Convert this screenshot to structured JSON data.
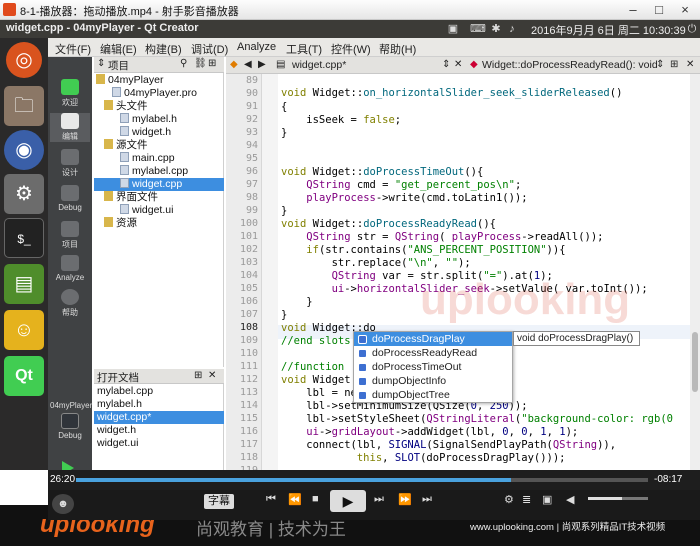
{
  "player_title": "8-1-播放器：拖动播放.mp4 - 射手影音播放器",
  "ubuntu": {
    "window_title": "widget.cpp - 04myPlayer - Qt Creator",
    "clock": "2016年9月月 6日 周二 10:30:39"
  },
  "menu": [
    "文件(F)",
    "编辑(E)",
    "构建(B)",
    "调试(D)",
    "Analyze",
    "工具(T)",
    "控件(W)",
    "帮助(H)"
  ],
  "modes": [
    "欢迎",
    "编辑",
    "设计",
    "Debug",
    "项目",
    "Analyze",
    "帮助"
  ],
  "kit": {
    "project": "04myPlayer",
    "config": "Debug"
  },
  "project_header": "项目",
  "tree": [
    {
      "label": "04myPlayer",
      "indent": 2,
      "type": "folder"
    },
    {
      "label": "04myPlayer.pro",
      "indent": 18,
      "type": "file"
    },
    {
      "label": "头文件",
      "indent": 10,
      "type": "folder"
    },
    {
      "label": "mylabel.h",
      "indent": 26,
      "type": "file"
    },
    {
      "label": "widget.h",
      "indent": 26,
      "type": "file"
    },
    {
      "label": "源文件",
      "indent": 10,
      "type": "folder"
    },
    {
      "label": "main.cpp",
      "indent": 26,
      "type": "file"
    },
    {
      "label": "mylabel.cpp",
      "indent": 26,
      "type": "file"
    },
    {
      "label": "widget.cpp",
      "indent": 26,
      "type": "file",
      "selected": true
    },
    {
      "label": "界面文件",
      "indent": 10,
      "type": "folder"
    },
    {
      "label": "widget.ui",
      "indent": 26,
      "type": "file"
    },
    {
      "label": "资源",
      "indent": 10,
      "type": "folder"
    }
  ],
  "open_docs": {
    "header": "打开文档",
    "items": [
      "mylabel.cpp",
      "mylabel.h",
      "widget.cpp*",
      "widget.h",
      "widget.ui"
    ]
  },
  "editor": {
    "file_tab": "widget.cpp*",
    "function_combo": "Widget::doProcessReadyRead(): void"
  },
  "line_numbers": [
    "89",
    "90",
    "91",
    "92",
    "93",
    "94",
    "95",
    "96",
    "97",
    "98",
    "99",
    "100",
    "101",
    "102",
    "103",
    "104",
    "105",
    "106",
    "107",
    "108",
    "109",
    "110",
    "111",
    "112",
    "113",
    "114",
    "115",
    "116",
    "117",
    "118",
    "119"
  ],
  "popup": {
    "items": [
      "doProcessDragPlay",
      "doProcessReadyRead",
      "doProcessTimeOut",
      "dumpObjectInfo",
      "dumpObjectTree"
    ],
    "tooltip": "void doProcessDragPlay()"
  },
  "watermark": "uplooking",
  "player": {
    "time_current": "26:20",
    "time_total": "-08:17",
    "subtitle_button": "字幕",
    "progress": 0.76
  },
  "banner": {
    "logo": "uplooking",
    "slogan": "尚观教育 | 技术为王",
    "url": "www.uplooking.com | 尚观系列精品IT技术视频"
  }
}
